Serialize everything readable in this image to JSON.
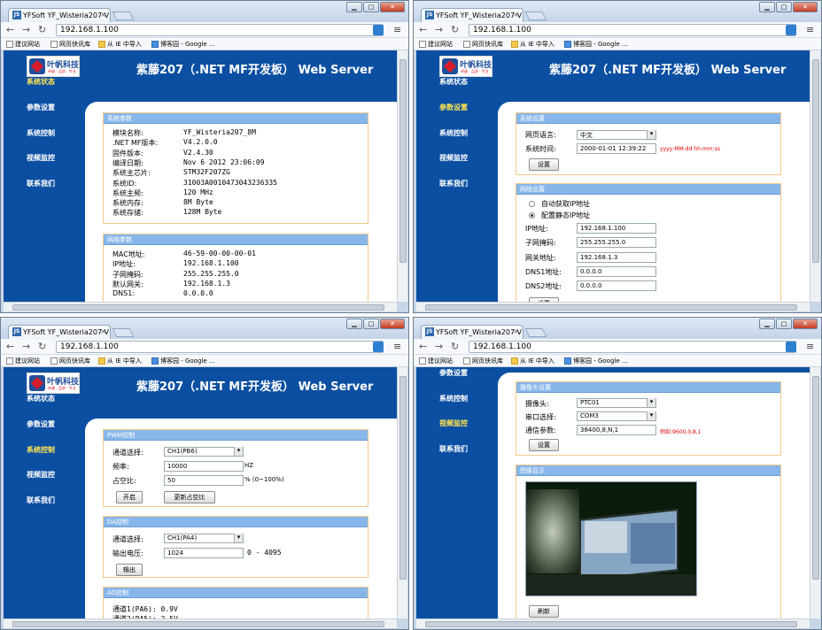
{
  "browser": {
    "tab_title": "YFSoft YF_Wisteria207 V",
    "tab_close": "×",
    "favicon": "JS",
    "url": "192.168.1.100",
    "min": "▁",
    "max": "□",
    "close": "✕",
    "back": "←",
    "forward": "→",
    "reload": "↻",
    "star": "☆",
    "menu": "≡",
    "bookmarks": [
      "建议网站",
      "网页快讯库",
      "从 IE 中导入",
      "博客园 - Google ..."
    ]
  },
  "site": {
    "logo_text": "叶帆科技",
    "logo_slogan": "卓越 · 品质 · 专业",
    "title": "紫藤207（.NET MF开发板） Web Server",
    "nav": [
      "系统状态",
      "参数设置",
      "系统控制",
      "视频监控",
      "联系我们"
    ]
  },
  "status": {
    "sys_header": "系统参数",
    "sys_rows": [
      [
        "模块名称:",
        "YF_Wisteria207_8M"
      ],
      [
        ".NET MF版本:",
        "V4.2.0.0"
      ],
      [
        "固件版本:",
        "V2.4.30"
      ],
      [
        "编译日期:",
        "Nov 6 2012 23:06:09"
      ],
      [
        "系统主芯片:",
        "STM32F207ZG"
      ],
      [
        "系统ID:",
        "31003A0010473043236335"
      ],
      [
        "系统主频:",
        "120 MHz"
      ],
      [
        "系统内存:",
        "8M Byte"
      ],
      [
        "系统存储:",
        "128M Byte"
      ]
    ],
    "net_header": "网络参数",
    "net_rows": [
      [
        "MAC地址:",
        "46-59-00-00-00-01"
      ],
      [
        "IP地址:",
        "192.168.1.100"
      ],
      [
        "子网掩码:",
        "255.255.255.0"
      ],
      [
        "默认网关:",
        "192.168.1.3"
      ],
      [
        "DNS1:",
        "0.0.0.0"
      ]
    ]
  },
  "settings": {
    "sys_header": "系统设置",
    "lang_label": "网页语言:",
    "lang_value": "中文",
    "time_label": "系统时间:",
    "time_value": "2000-01-01 12:39:22",
    "time_hint": "yyyy-MM-dd hh:mm:ss",
    "save": "设置",
    "net_header": "网络设置",
    "dhcp": "自动获取IP地址",
    "static": "配置静态IP地址",
    "fields": [
      [
        "IP地址:",
        "192.168.1.100"
      ],
      [
        "子网掩码:",
        "255.255.255.0"
      ],
      [
        "网关地址:",
        "192.168.1.3"
      ],
      [
        "DNS1地址:",
        "0.0.0.0"
      ],
      [
        "DNS2地址:",
        "0.0.0.0"
      ]
    ]
  },
  "control": {
    "pwm_header": "PWM控制",
    "ch_label": "通道选择:",
    "ch_value": "CH1(PB6)",
    "freq_label": "频率:",
    "freq_value": "10000",
    "freq_unit": "HZ",
    "duty_label": "占空比:",
    "duty_value": "50",
    "duty_unit": "% (0~100%)",
    "start": "开启",
    "update": "更新占空比",
    "da_header": "DA控制",
    "da_ch_label": "通道选择:",
    "da_ch_value": "CH1(PA4)",
    "volt_label": "输出电压:",
    "volt_value": "1024",
    "volt_range": "0 - 4095",
    "output": "输出",
    "ad_header": "AD控制",
    "ad_rows": [
      "通道1(PA6): 0.9V",
      "通道2(PA5): 2.5V"
    ]
  },
  "video": {
    "cam_header": "摄像头设置",
    "cam_label": "摄像头:",
    "cam_value": "PTC01",
    "port_label": "串口选择:",
    "port_value": "COM3",
    "param_label": "通信参数:",
    "param_value": "38400,8,N,1",
    "param_hint": "例如:9600,0,8,1",
    "save": "设置",
    "img_header": "图像显示",
    "refresh": "刷新"
  }
}
